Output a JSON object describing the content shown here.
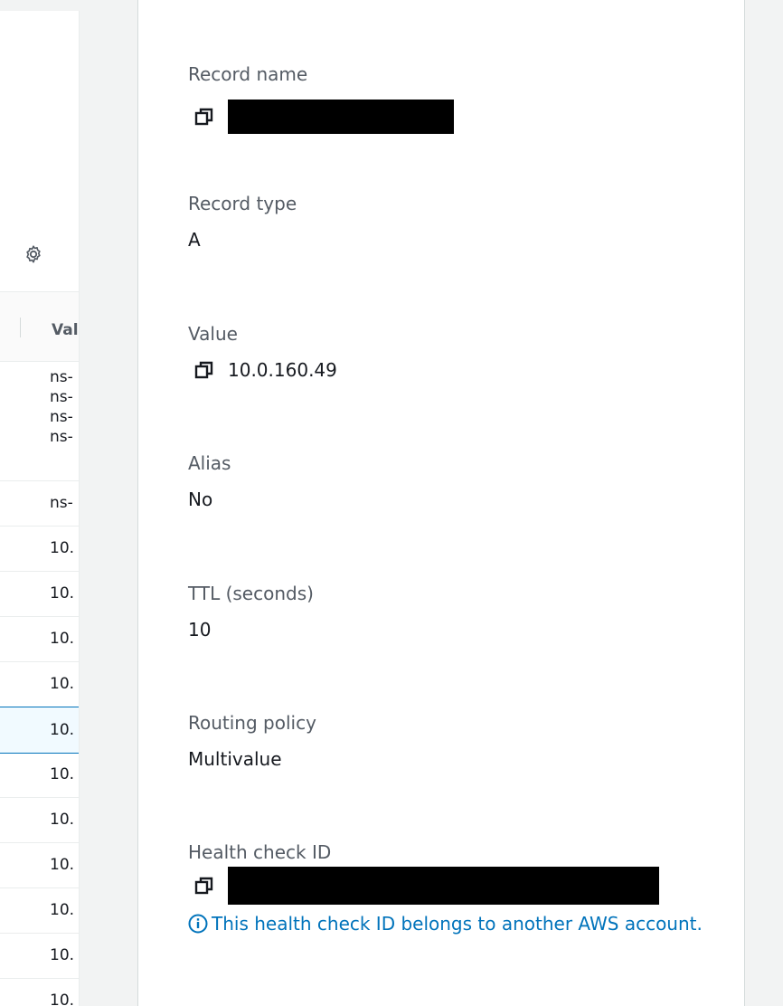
{
  "table": {
    "column_header": "Val",
    "rows": [
      {
        "lines": [
          "ns-",
          "ns-",
          "ns-",
          "ns-"
        ]
      },
      {
        "lines": [
          "ns-"
        ]
      },
      {
        "lines": [
          "10."
        ]
      },
      {
        "lines": [
          "10."
        ]
      },
      {
        "lines": [
          "10."
        ]
      },
      {
        "lines": [
          "10."
        ]
      },
      {
        "lines": [
          "10."
        ],
        "selected": true
      },
      {
        "lines": [
          "10."
        ]
      },
      {
        "lines": [
          "10."
        ]
      },
      {
        "lines": [
          "10."
        ]
      },
      {
        "lines": [
          "10."
        ]
      },
      {
        "lines": [
          "10."
        ]
      },
      {
        "lines": [
          "10."
        ]
      }
    ]
  },
  "details": {
    "record_name": {
      "label": "Record name",
      "value": ""
    },
    "record_type": {
      "label": "Record type",
      "value": "A"
    },
    "value": {
      "label": "Value",
      "value": "10.0.160.49"
    },
    "alias": {
      "label": "Alias",
      "value": "No"
    },
    "ttl": {
      "label": "TTL (seconds)",
      "value": "10"
    },
    "routing_policy": {
      "label": "Routing policy",
      "value": "Multivalue"
    },
    "health_check_id": {
      "label": "Health check ID",
      "value": "",
      "note": "This health check ID belongs to another AWS account."
    }
  },
  "colors": {
    "link": "#0073bb",
    "selected_border": "#0073bb",
    "redaction": "#000000"
  }
}
